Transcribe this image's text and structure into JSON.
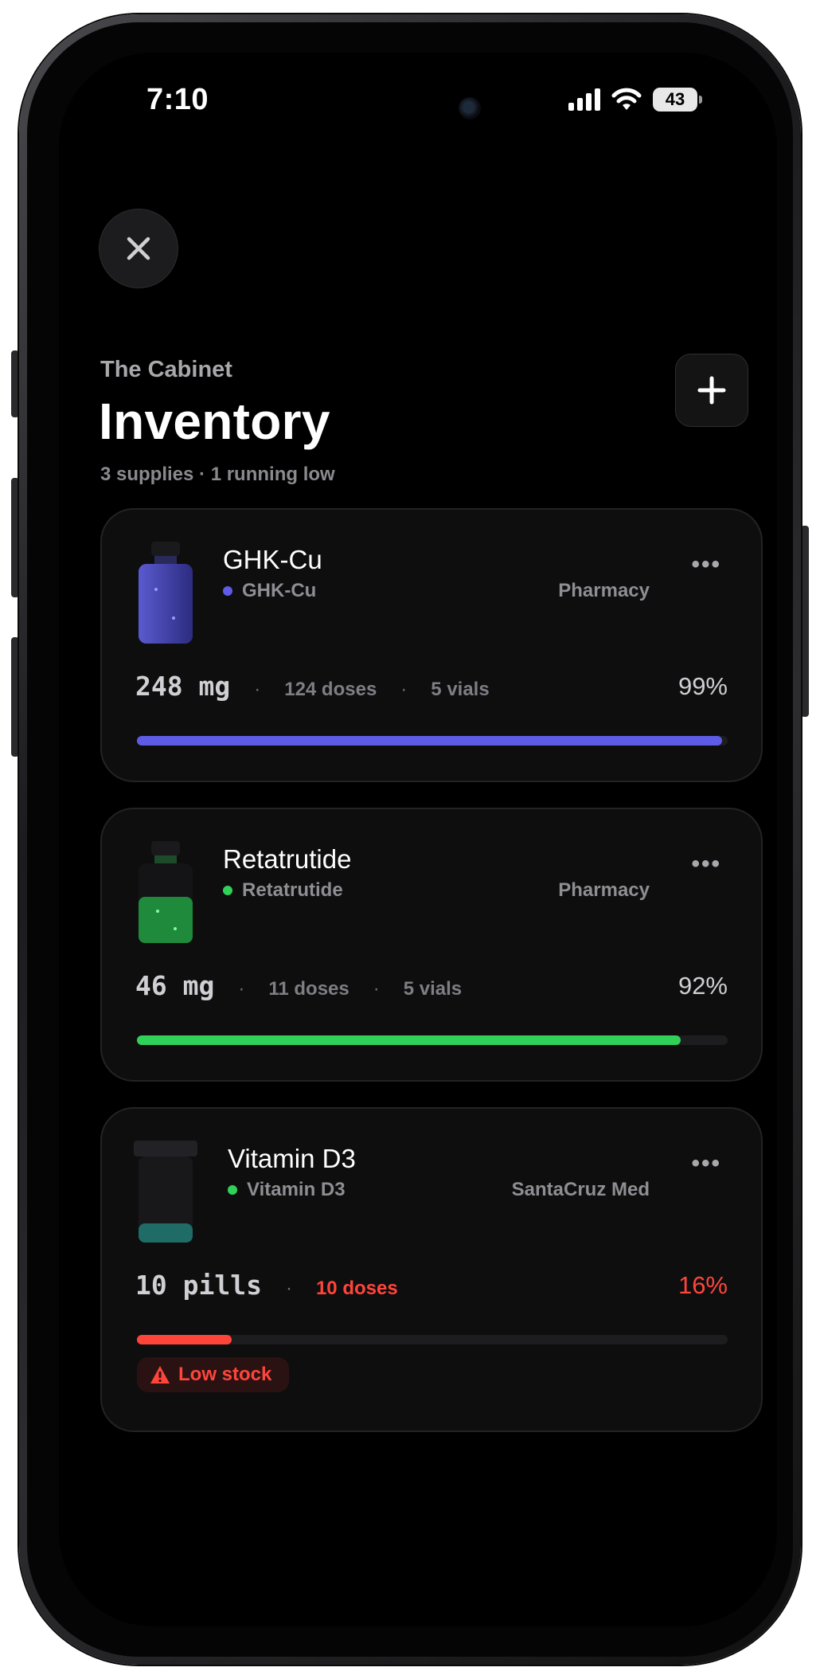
{
  "status_bar": {
    "time": "7:10",
    "battery": "43"
  },
  "header": {
    "eyebrow": "The Cabinet",
    "title": "Inventory",
    "subtitle": "3 supplies · 1 running low"
  },
  "colors": {
    "ghk": "#5e5ce6",
    "reta": "#30d158",
    "vitd": "#30d158",
    "low": "#ff453a"
  },
  "icons": {
    "close": "close-icon",
    "add": "plus-icon",
    "more": "ellipsis-icon",
    "warning": "warning-triangle-icon"
  },
  "items": [
    {
      "name": "GHK-Cu",
      "subtitle": "GHK-Cu",
      "source": "Pharmacy",
      "more": "•••",
      "amount": "248 mg",
      "doses": "124 doses",
      "vials": "5 vials",
      "percent": "99%",
      "fill": 0.99
    },
    {
      "name": "Retatrutide",
      "subtitle": "Retatrutide",
      "source": "Pharmacy",
      "more": "•••",
      "amount": "46 mg",
      "doses": "11 doses",
      "vials": "5 vials",
      "percent": "92%",
      "fill": 0.92
    },
    {
      "name": "Vitamin D3",
      "subtitle": "Vitamin D3",
      "source": "SantaCruz Med",
      "more": "•••",
      "amount": "10 pills",
      "doses": "10 doses",
      "percent": "16%",
      "fill": 0.16,
      "badge": "Low stock"
    }
  ]
}
